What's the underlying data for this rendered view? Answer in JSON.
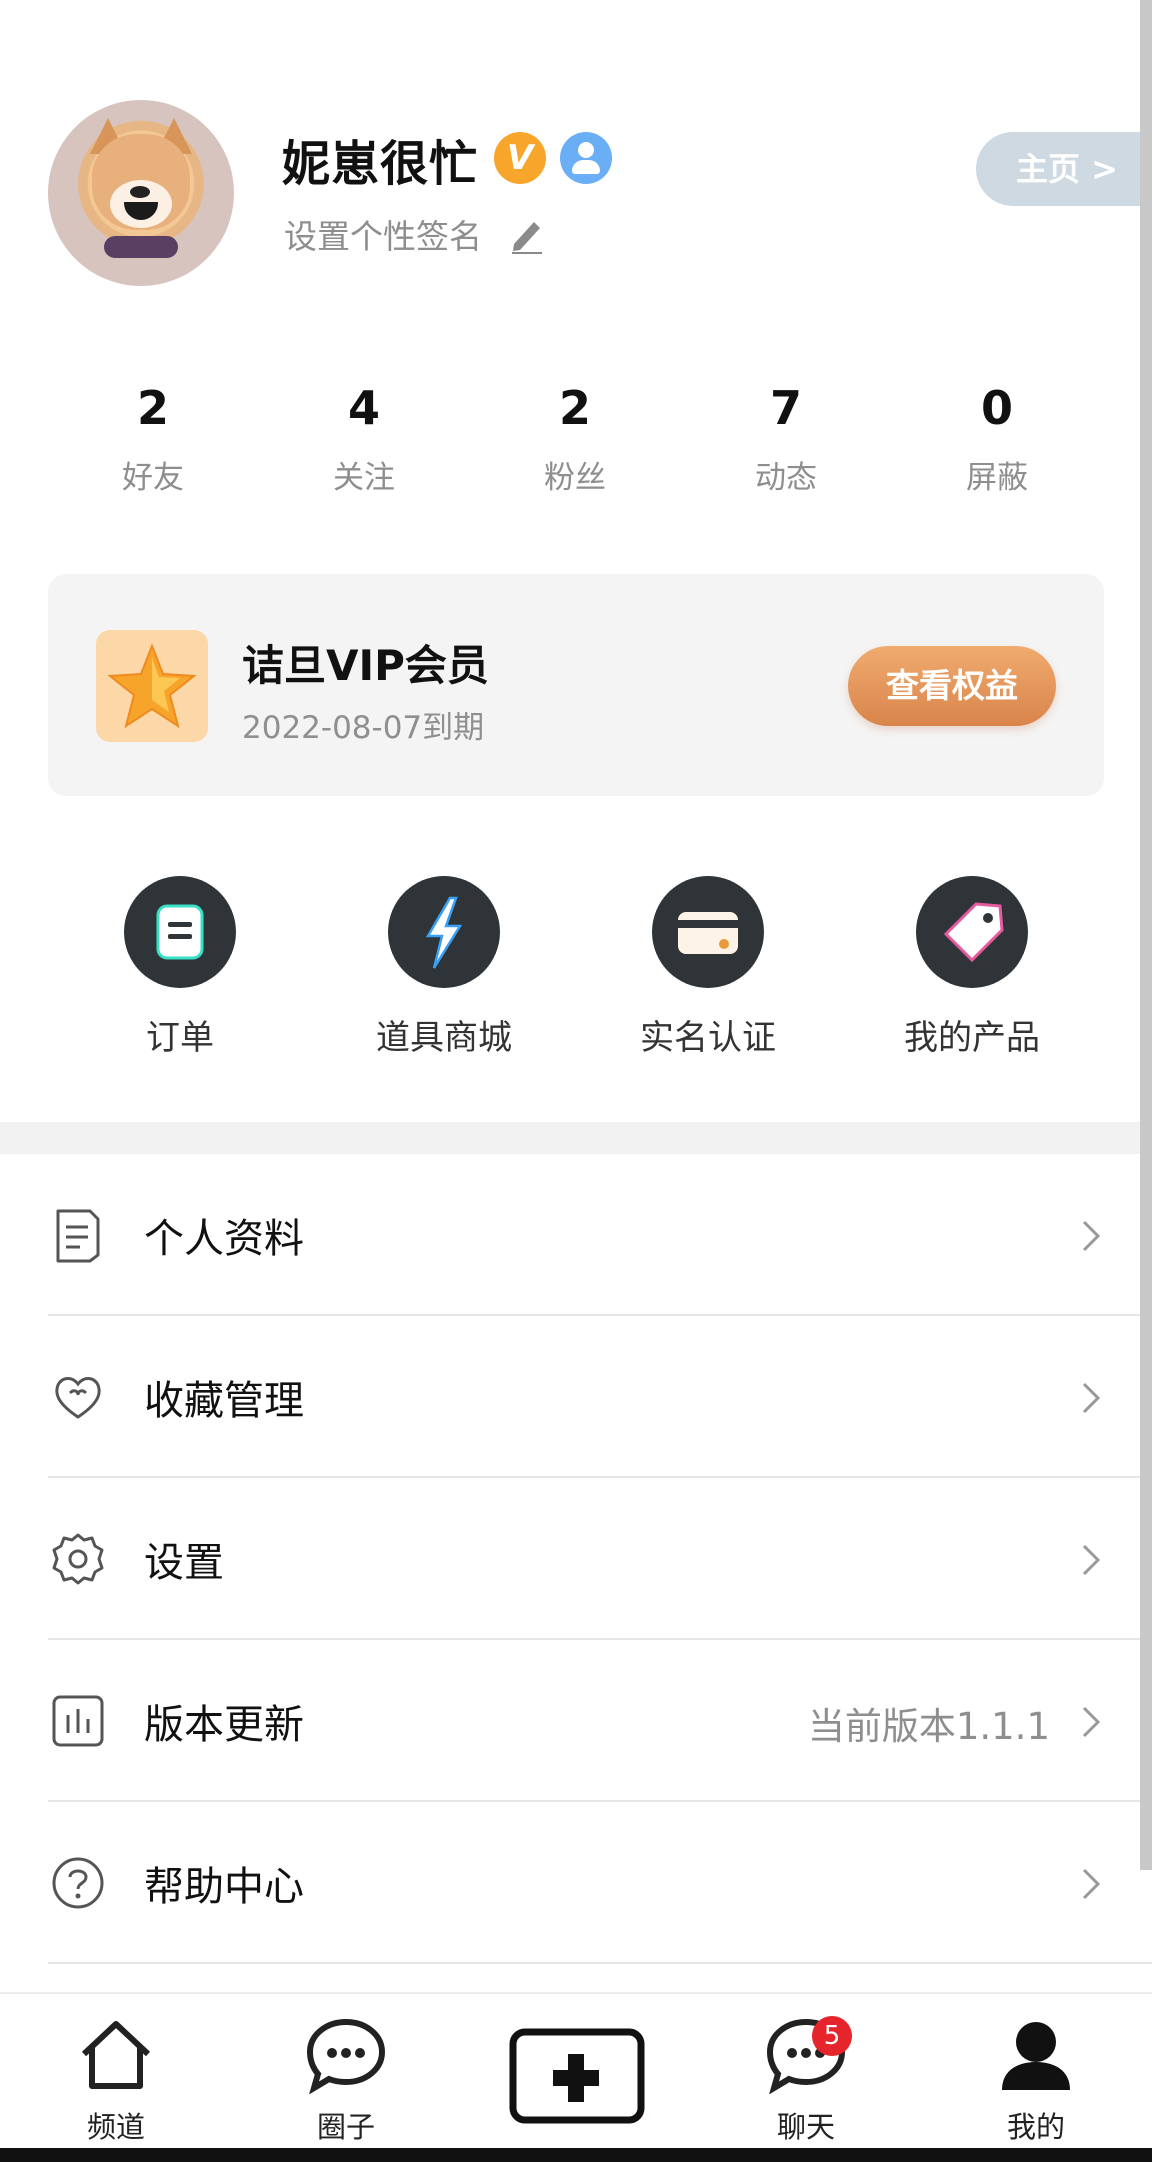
{
  "profile": {
    "name": "妮崽很忙",
    "vip_badge": "V",
    "signature": "设置个性签名",
    "home_button": "主页 >"
  },
  "stats": [
    {
      "value": "2",
      "label": "好友"
    },
    {
      "value": "4",
      "label": "关注"
    },
    {
      "value": "2",
      "label": "粉丝"
    },
    {
      "value": "7",
      "label": "动态"
    },
    {
      "value": "0",
      "label": "屏蔽"
    }
  ],
  "vip": {
    "title": "诘旦VIP会员",
    "expiry": "2022-08-07到期",
    "button": "查看权益"
  },
  "quick_actions": [
    {
      "label": "订单",
      "icon": "order-icon"
    },
    {
      "label": "道具商城",
      "icon": "lightning-icon"
    },
    {
      "label": "实名认证",
      "icon": "card-icon"
    },
    {
      "label": "我的产品",
      "icon": "tag-icon"
    }
  ],
  "menu": [
    {
      "label": "个人资料",
      "icon": "document-icon",
      "value": ""
    },
    {
      "label": "收藏管理",
      "icon": "heart-icon",
      "value": ""
    },
    {
      "label": "设置",
      "icon": "gear-icon",
      "value": ""
    },
    {
      "label": "版本更新",
      "icon": "chart-icon",
      "value": "当前版本1.1.1"
    },
    {
      "label": "帮助中心",
      "icon": "help-icon",
      "value": ""
    }
  ],
  "bottom_nav": [
    {
      "label": "频道",
      "icon": "home-icon"
    },
    {
      "label": "圈子",
      "icon": "chat-bubble-icon"
    },
    {
      "label": "",
      "icon": "plus-icon"
    },
    {
      "label": "聊天",
      "icon": "chat-bubble-icon",
      "badge": "5"
    },
    {
      "label": "我的",
      "icon": "person-icon"
    }
  ],
  "colors": {
    "accent_orange": "#f7a62b",
    "vip_button": "#d9844b",
    "badge_red": "#e5242b",
    "icon_dark": "#2f3438"
  }
}
